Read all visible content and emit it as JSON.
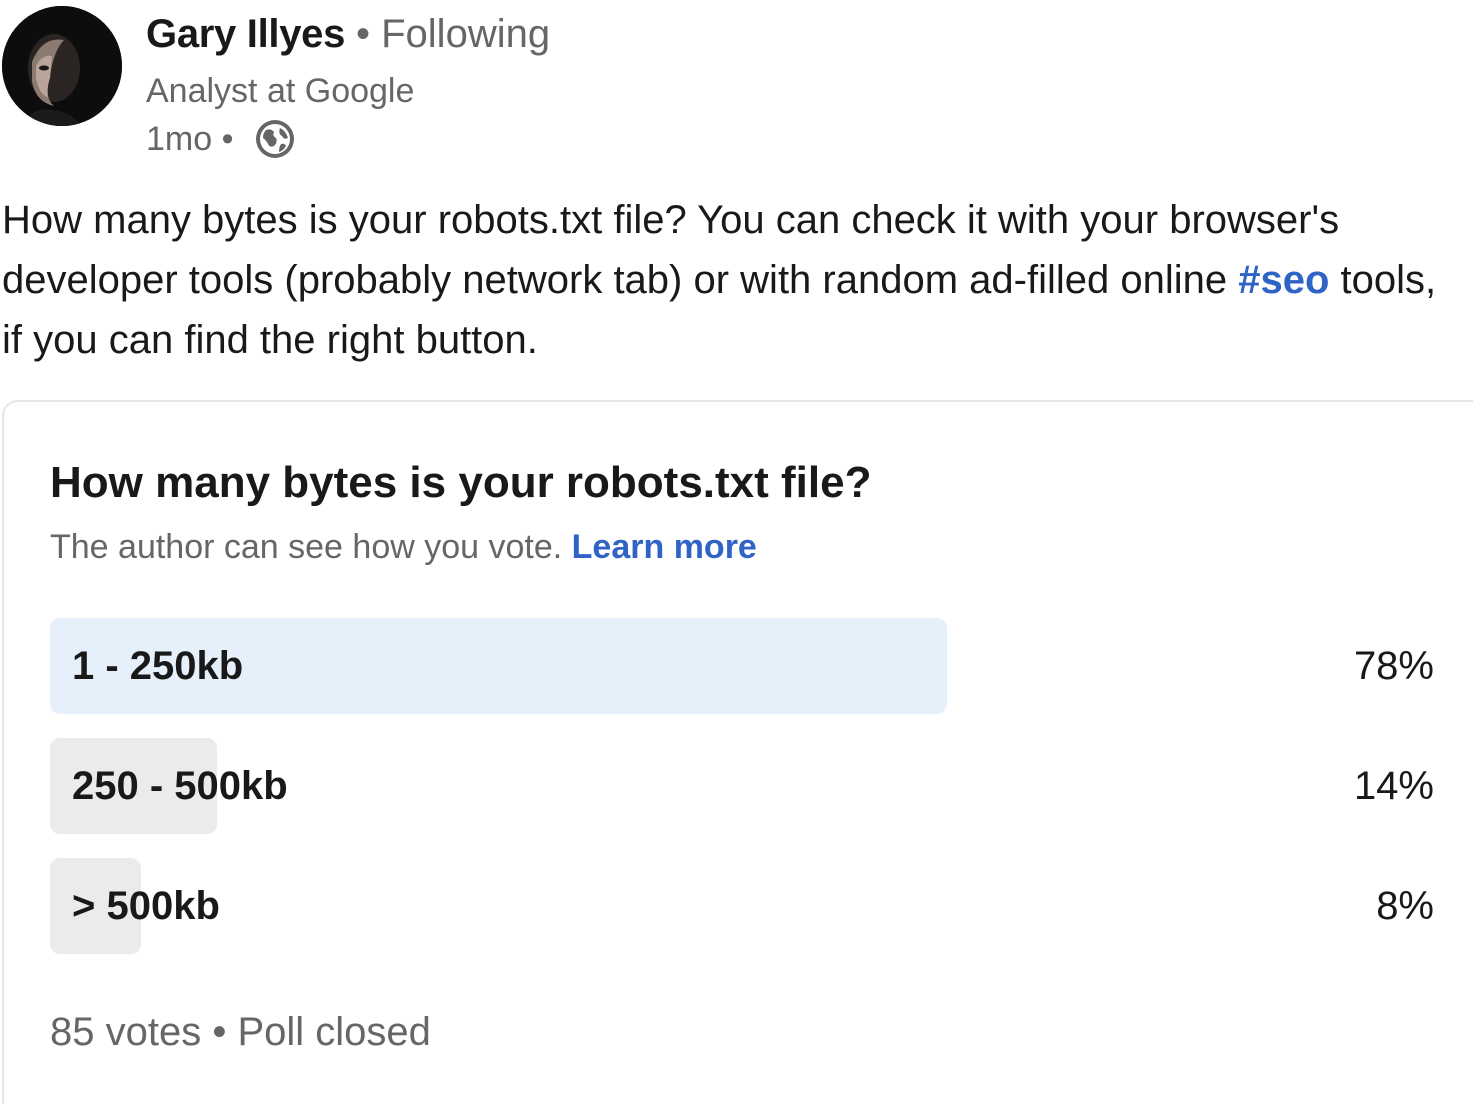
{
  "author": {
    "name": "Gary Illyes",
    "follow_status": "• Following",
    "headline": "Analyst at Google",
    "time": "1mo •",
    "visibility_icon": "globe-icon"
  },
  "post": {
    "text_before": "How many bytes is your robots.txt file? You can check it with your browser's developer tools (probably network tab) or with random ad-filled online ",
    "hashtag": "#seo",
    "text_after": " tools, if you can find the right button."
  },
  "poll": {
    "question": "How many bytes is your robots.txt file?",
    "privacy_note": "The author can see how you vote. ",
    "learn_more": "Learn more",
    "options": [
      {
        "label": "1 - 250kb",
        "percent": "78%",
        "fill_fraction": 0.648,
        "selected": true
      },
      {
        "label": "250 - 500kb",
        "percent": "14%",
        "fill_fraction": 0.121,
        "selected": false
      },
      {
        "label": "> 500kb",
        "percent": "8%",
        "fill_fraction": 0.066,
        "selected": false
      }
    ],
    "footer": "85 votes • Poll closed"
  },
  "colors": {
    "link": "#2f63c6",
    "selected_fill": "#e6f0fb",
    "unselected_fill": "#ebebeb",
    "muted_text": "#666666"
  }
}
